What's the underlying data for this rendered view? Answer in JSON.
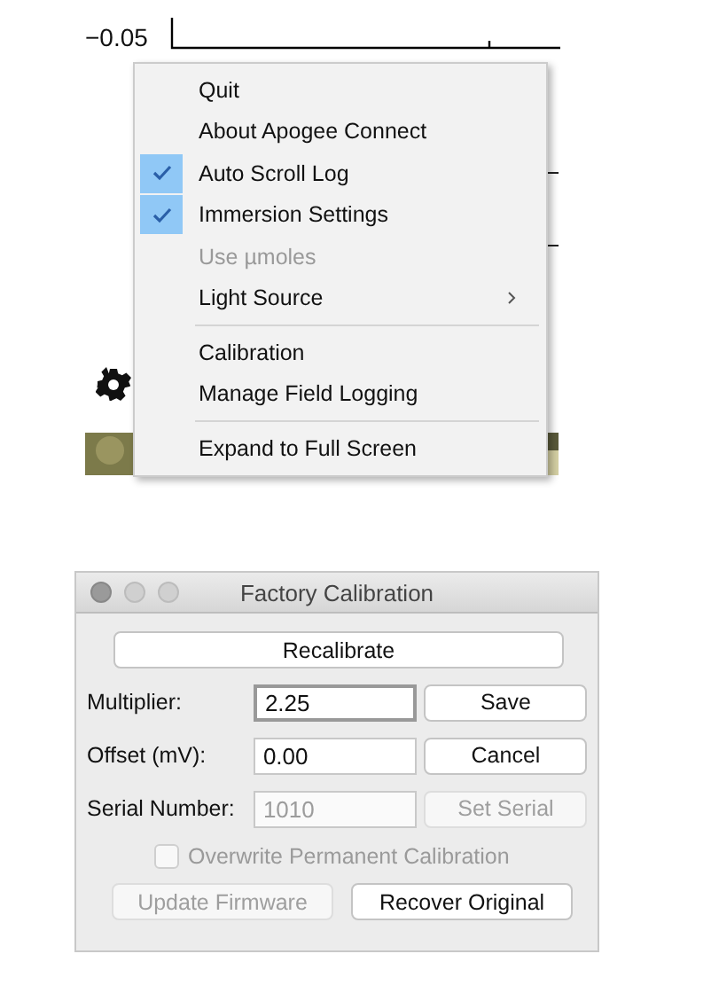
{
  "plot": {
    "y_tick": "−0.05"
  },
  "menu": {
    "items": [
      {
        "kind": "item",
        "label": "Quit",
        "checked": false,
        "disabled": false,
        "submenu": false
      },
      {
        "kind": "item",
        "label": "About Apogee Connect",
        "checked": false,
        "disabled": false,
        "submenu": false
      },
      {
        "kind": "item",
        "label": "Auto Scroll Log",
        "checked": true,
        "disabled": false,
        "submenu": false
      },
      {
        "kind": "item",
        "label": "Immersion Settings",
        "checked": true,
        "disabled": false,
        "submenu": false
      },
      {
        "kind": "item",
        "label": "Use µmoles",
        "checked": false,
        "disabled": true,
        "submenu": false
      },
      {
        "kind": "item",
        "label": "Light Source",
        "checked": false,
        "disabled": false,
        "submenu": true
      },
      {
        "kind": "separator"
      },
      {
        "kind": "item",
        "label": "Calibration",
        "checked": false,
        "disabled": false,
        "submenu": false
      },
      {
        "kind": "item",
        "label": "Manage Field Logging",
        "checked": false,
        "disabled": false,
        "submenu": false
      },
      {
        "kind": "separator"
      },
      {
        "kind": "item",
        "label": "Expand to Full Screen",
        "checked": false,
        "disabled": false,
        "submenu": false
      }
    ]
  },
  "dialog": {
    "title": "Factory Calibration",
    "recalibrate": "Recalibrate",
    "rows": [
      {
        "label": "Multiplier:",
        "value": "2.25",
        "focused": true,
        "disabled": false,
        "button": "Save",
        "button_disabled": false
      },
      {
        "label": "Offset (mV):",
        "value": "0.00",
        "focused": false,
        "disabled": false,
        "button": "Cancel",
        "button_disabled": false
      },
      {
        "label": "Serial Number:",
        "value": "1010",
        "focused": false,
        "disabled": true,
        "button": "Set Serial",
        "button_disabled": true
      }
    ],
    "checkbox": {
      "label": "Overwrite Permanent Calibration",
      "checked": false,
      "disabled": true
    },
    "buttons": [
      {
        "label": "Update Firmware",
        "disabled": true
      },
      {
        "label": "Recover Original",
        "disabled": false
      }
    ]
  }
}
